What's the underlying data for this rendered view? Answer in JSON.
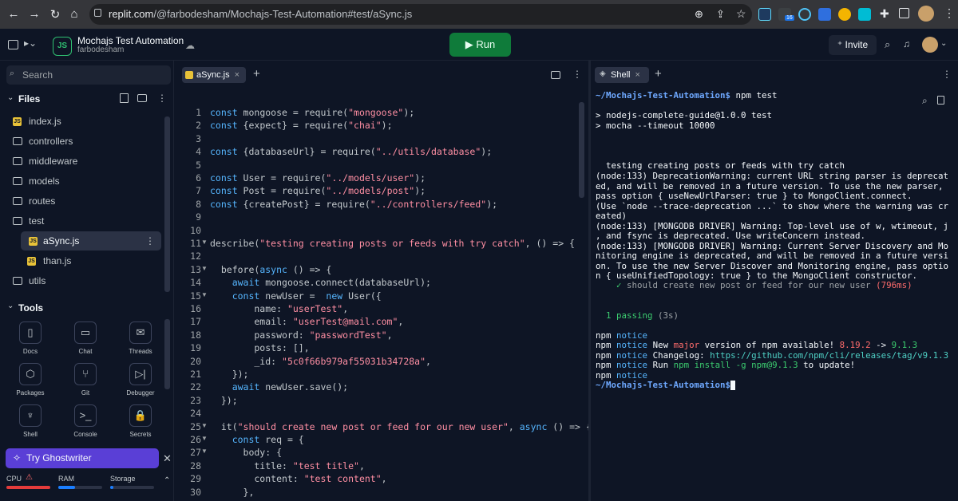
{
  "browser": {
    "url_host": "replit.com",
    "url_path": "/@farbodesham/Mochajs-Test-Automation#test/aSync.js",
    "ext_badge": "16"
  },
  "header": {
    "project_title": "Mochajs Test Automation",
    "owner": "farbodesham",
    "logo_text": "JS",
    "run_label": "Run",
    "invite_label": "Invite"
  },
  "sidebar": {
    "search_placeholder": "Search",
    "files_label": "Files",
    "files": [
      {
        "name": "index.js",
        "type": "js"
      },
      {
        "name": "controllers",
        "type": "folder"
      },
      {
        "name": "middleware",
        "type": "folder"
      },
      {
        "name": "models",
        "type": "folder"
      },
      {
        "name": "routes",
        "type": "folder"
      },
      {
        "name": "test",
        "type": "folder-open"
      },
      {
        "name": "aSync.js",
        "type": "js"
      },
      {
        "name": "than.js",
        "type": "js"
      },
      {
        "name": "utils",
        "type": "folder"
      }
    ],
    "tools_label": "Tools",
    "tools": [
      "Docs",
      "Chat",
      "Threads",
      "Packages",
      "Git",
      "Debugger",
      "Shell",
      "Console",
      "Secrets"
    ],
    "ghostwriter_label": "Try Ghostwriter",
    "meters": {
      "cpu": "CPU",
      "ram": "RAM",
      "storage": "Storage"
    }
  },
  "editor": {
    "tab_label": "aSync.js",
    "breadcrumb": "...",
    "lines": [
      {
        "n": "1",
        "code": "const mongoose = require(\"mongoose\");"
      },
      {
        "n": "2",
        "code": "const {expect} = require(\"chai\");"
      },
      {
        "n": "3",
        "code": ""
      },
      {
        "n": "4",
        "code": "const {databaseUrl} = require(\"../utils/database\");"
      },
      {
        "n": "5",
        "code": ""
      },
      {
        "n": "6",
        "code": "const User = require(\"../models/user\");"
      },
      {
        "n": "7",
        "code": "const Post = require(\"../models/post\");"
      },
      {
        "n": "8",
        "code": "const {createPost} = require(\"../controllers/feed\");"
      },
      {
        "n": "9",
        "code": ""
      },
      {
        "n": "10",
        "code": ""
      },
      {
        "n": "11",
        "code": "describe(\"testing creating posts or feeds with try catch\", () => {"
      },
      {
        "n": "12",
        "code": ""
      },
      {
        "n": "13",
        "code": "  before(async () => {"
      },
      {
        "n": "14",
        "code": "    await mongoose.connect(databaseUrl);"
      },
      {
        "n": "15",
        "code": "    const newUser =  new User({"
      },
      {
        "n": "16",
        "code": "        name: \"userTest\","
      },
      {
        "n": "17",
        "code": "        email: \"userTest@mail.com\","
      },
      {
        "n": "18",
        "code": "        password: \"passwordTest\","
      },
      {
        "n": "19",
        "code": "        posts: [],"
      },
      {
        "n": "20",
        "code": "        _id: \"5c0f66b979af55031b34728a\","
      },
      {
        "n": "21",
        "code": "    });"
      },
      {
        "n": "22",
        "code": "    await newUser.save();"
      },
      {
        "n": "23",
        "code": "  });"
      },
      {
        "n": "24",
        "code": ""
      },
      {
        "n": "25",
        "code": "  it(\"should create new post or feed for our new user\", async () => {"
      },
      {
        "n": "26",
        "code": "    const req = {"
      },
      {
        "n": "27",
        "code": "      body: {"
      },
      {
        "n": "28",
        "code": "        title: \"test title\","
      },
      {
        "n": "29",
        "code": "        content: \"test content\","
      },
      {
        "n": "30",
        "code": "      },"
      }
    ]
  },
  "shell": {
    "tab_label": "Shell",
    "prompt1": "~/Mochajs-Test-Automation$",
    "cmd1": " npm test",
    "out1": "> nodejs-complete-guide@1.0.0 test",
    "out2": "> mocha --timeout 10000",
    "suite": "  testing creating posts or feeds with try catch",
    "warn": [
      "(node:133) DeprecationWarning: current URL string parser is deprecat",
      "ed, and will be removed in a future version. To use the new parser,",
      "pass option { useNewUrlParser: true } to MongoClient.connect.",
      "(Use `node --trace-deprecation ...` to show where the warning was cr",
      "eated)",
      "(node:133) [MONGODB DRIVER] Warning: Top-level use of w, wtimeout, j",
      ", and fsync is deprecated. Use writeConcern instead.",
      "(node:133) [MONGODB DRIVER] Warning: Current Server Discovery and Mo",
      "nitoring engine is deprecated, and will be removed in a future versi",
      "on. To use the new Server Discover and Monitoring engine, pass optio",
      "n { useUnifiedTopology: true } to the MongoClient constructor."
    ],
    "test_pass": "should create new post or feed for our new user",
    "test_time": "(796ms)",
    "passing": "1 passing",
    "passing_time": "(3s)",
    "npm_label": "npm",
    "notice_label": "notice",
    "notice1a": "New ",
    "notice1b": "major",
    "notice1c": " version of npm available! ",
    "old_ver": "8.19.2",
    "arrow": " -> ",
    "new_ver": "9.1.3",
    "changelog_label": "Changelog: ",
    "changelog_url": "https://github.com/npm/cli/releases/tag/v9.1.3",
    "run_label": "Run ",
    "run_cmd": "npm install -g npm@9.1.3",
    "update_label": " to update!",
    "prompt2": "~/Mochajs-Test-Automation$"
  },
  "colors": {
    "accent": "#0f7b3a",
    "ghostwriter": "#5a3fd6",
    "prompt": "#6ea8fe"
  }
}
